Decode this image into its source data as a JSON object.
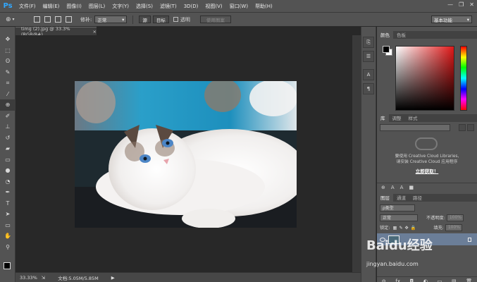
{
  "app": {
    "logo": "Ps"
  },
  "menubar": {
    "items": [
      "文件(F)",
      "编辑(E)",
      "图像(I)",
      "图层(L)",
      "文字(Y)",
      "选择(S)",
      "滤镜(T)",
      "3D(D)",
      "视图(V)",
      "窗口(W)",
      "帮助(H)"
    ],
    "window_controls": [
      "—",
      "❐",
      "✕"
    ]
  },
  "options": {
    "feather_label": "修补:",
    "mode_value": "正常",
    "source_label": "源",
    "target_label": "目标",
    "transparent_label": "透明",
    "use_pattern_label": "使用图案",
    "workspace_value": "基本功能"
  },
  "document": {
    "tab_title": "timg (2).jpg @ 33.3%(RGB/8#)",
    "close_glyph": "×",
    "zoom": "33.33%",
    "doc_info": "文档:5.05M/5.85M"
  },
  "tools": [
    "move-icon",
    "marquee-icon",
    "lasso-icon",
    "quick-select-icon",
    "crop-icon",
    "eyedropper-icon",
    "patch-icon",
    "brush-icon",
    "stamp-icon",
    "history-brush-icon",
    "eraser-icon",
    "gradient-icon",
    "blur-icon",
    "dodge-icon",
    "pen-icon",
    "type-icon",
    "path-select-icon",
    "shape-icon",
    "hand-icon",
    "zoom-icon"
  ],
  "color_panel": {
    "tabs": [
      "颜色",
      "色板"
    ]
  },
  "library_panel": {
    "tabs": [
      "库",
      "调整",
      "样式"
    ],
    "message_line1": "要使用 Creative Cloud Libraries,",
    "message_line2": "请安装 Creative Cloud 应用程序",
    "install_link": "立即获取！"
  },
  "layers_panel": {
    "tabs": [
      "图层",
      "通道",
      "路径"
    ],
    "filter_value": "ρ类型",
    "blend_mode": "正常",
    "opacity_label": "不透明度:",
    "opacity_value": "100%",
    "lock_label": "锁定:",
    "fill_label": "填充:",
    "fill_value": "100%",
    "footer_icons": [
      "⊖",
      "fx",
      "◘",
      "◐",
      "▭",
      "▤",
      "🗑"
    ]
  },
  "watermark": {
    "brand": "Baidu经验",
    "url": "jingyan.baidu.com"
  },
  "colors": {
    "accent": "#31a8ff",
    "selected_layer": "#6b7e98"
  }
}
